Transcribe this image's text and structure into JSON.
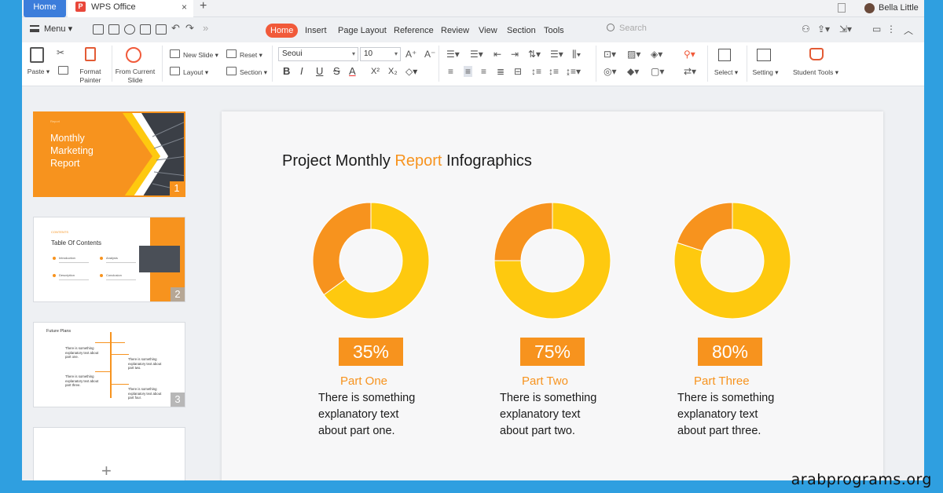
{
  "titlebar": {
    "home_tab": "Home",
    "doc_tab": "WPS Office",
    "doc_icon_letter": "P",
    "close_glyph": "×",
    "new_tab_glyph": "+",
    "username": "Bella Little"
  },
  "menubar": {
    "menu_label": "Menu",
    "tabs": [
      "Home",
      "Insert",
      "Page Layout",
      "Reference",
      "Review",
      "View",
      "Section",
      "Tools"
    ],
    "active_tab": "Home",
    "search_placeholder": "Search"
  },
  "ribbon": {
    "paste": "Paste",
    "format_painter": "Format Painter",
    "from_current_slide": "From Current Slide",
    "new_slide": "New Slide",
    "layout": "Layout",
    "reset": "Reset",
    "section": "Section",
    "font_name": "Seoui",
    "font_size": "10",
    "bold": "B",
    "italic": "I",
    "underline": "U",
    "strike": "S",
    "font_color": "A",
    "superscript": "X²",
    "subscript": "X₂",
    "grow_font": "A⁺",
    "shrink_font": "A⁻",
    "select": "Select",
    "setting": "Setting",
    "student_tools": "Student Tools"
  },
  "thumbnails": [
    {
      "number": "1",
      "title": "Monthly Marketing Report",
      "small_label": "Report"
    },
    {
      "number": "2",
      "title": "Table Of Contents",
      "small_label": "CONTENTS",
      "items": [
        "Introduction",
        "Analysis",
        "Description",
        "Conclusion"
      ]
    },
    {
      "number": "3",
      "title": "Future Plans",
      "texts": [
        "There is something explanatory text about part one.",
        "There is something explanatory text about part two.",
        "There is something explanatory text about part three.",
        "There is something explanatory text about part four."
      ]
    }
  ],
  "add_slide_glyph": "+",
  "slide": {
    "title_pre": "Project Monthly ",
    "title_highlight": "Report",
    "title_post": " Infographics",
    "parts": [
      {
        "percent_label": "35%",
        "value": 35,
        "name": "Part One",
        "description": "There is something explanatory text about part one."
      },
      {
        "percent_label": "75%",
        "value": 75,
        "name": "Part Two",
        "description": "There is something explanatory text about part two."
      },
      {
        "percent_label": "80%",
        "value": 80,
        "name": "Part Three",
        "description": "There is something explanatory text about part three."
      }
    ]
  },
  "chart_data": [
    {
      "type": "pie",
      "categories": [
        "Part One",
        "Remainder"
      ],
      "values": [
        35,
        65
      ]
    },
    {
      "type": "pie",
      "categories": [
        "Part Two",
        "Remainder"
      ],
      "values": [
        75,
        25
      ]
    },
    {
      "type": "pie",
      "categories": [
        "Part Three",
        "Remainder"
      ],
      "values": [
        80,
        20
      ]
    }
  ],
  "colors": {
    "orange": "#f7931e",
    "yellow": "#fec90f",
    "active_tab": "#f15a3a"
  },
  "watermark": "arabprograms.org"
}
